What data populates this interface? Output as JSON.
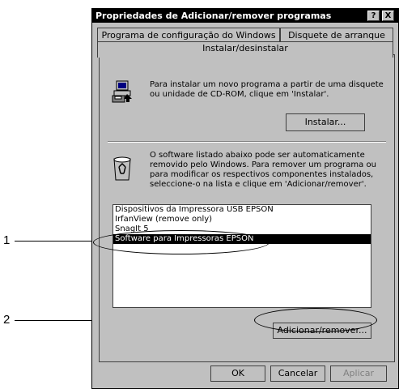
{
  "window": {
    "title": "Propriedades de Adicionar/remover programas",
    "help_button": "?",
    "close_button": "X"
  },
  "tabs": {
    "back": [
      "Programa de configuração do Windows",
      "Disquete de arranque"
    ],
    "active": "Instalar/desinstalar"
  },
  "install_section": {
    "text": "Para instalar um novo programa a partir de uma disquete ou unidade de CD-ROM, clique em 'Instalar'.",
    "button_label": "Instalar..."
  },
  "remove_section": {
    "text": "O software listado abaixo pode ser automaticamente removido pelo Windows. Para remover um programa ou para modificar os respectivos componentes instalados, seleccione-o na lista e clique em 'Adicionar/remover'."
  },
  "program_list": {
    "items": [
      {
        "label": "Dispositivos da Impressora USB EPSON",
        "selected": false
      },
      {
        "label": "IrfanView (remove only)",
        "selected": false
      },
      {
        "label": "SnagIt 5",
        "selected": false
      },
      {
        "label": "Software para Impressoras EPSON",
        "selected": true
      }
    ]
  },
  "add_remove_button": "Adicionar/remover...",
  "footer_buttons": {
    "ok": "OK",
    "cancel": "Cancelar",
    "apply": "Aplicar"
  },
  "callouts": {
    "one": "1",
    "two": "2"
  }
}
